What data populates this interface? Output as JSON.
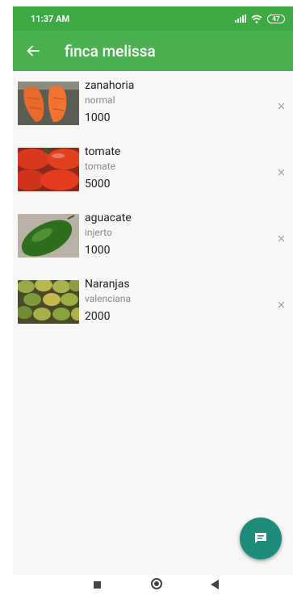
{
  "status_bar": {
    "time": "11:37 AM",
    "battery": "47",
    "icons": [
      "signal-icon",
      "wifi-icon",
      "battery-icon"
    ]
  },
  "app_bar": {
    "title": "finca melissa",
    "back_icon": "arrow-left-icon"
  },
  "items": [
    {
      "name": "zanahoria",
      "variety": "normal",
      "quantity": "1000",
      "image": "carrot-photo"
    },
    {
      "name": "tomate",
      "variety": "tomate",
      "quantity": "5000",
      "image": "tomato-photo"
    },
    {
      "name": "aguacate",
      "variety": "injerto",
      "quantity": "1000",
      "image": "avocado-photo"
    },
    {
      "name": "Naranjas",
      "variety": "valenciana",
      "quantity": "2000",
      "image": "oranges-photo"
    }
  ],
  "fab": {
    "icon": "chat-icon"
  },
  "colors": {
    "status_bar": "#3fa943",
    "app_bar": "#4caf50",
    "fab": "#1e8c7a",
    "background": "#f7f7f7"
  }
}
